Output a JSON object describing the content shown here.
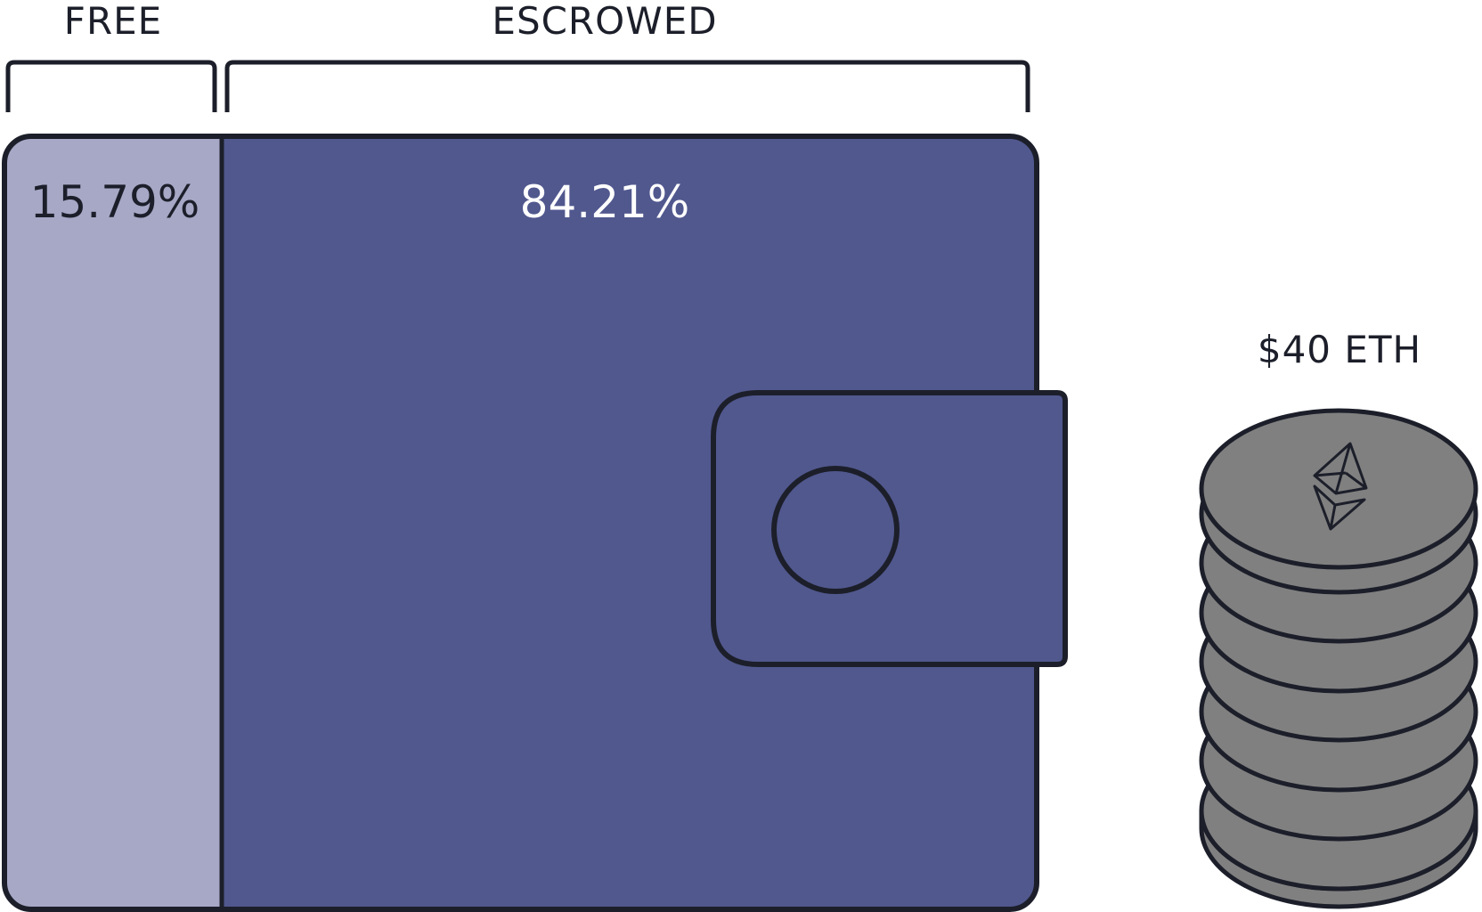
{
  "sections": {
    "free": {
      "label": "FREE",
      "percent_text": "15.79%",
      "share_percent": 15.79
    },
    "escrowed": {
      "label": "ESCROWED",
      "percent_text": "84.21%",
      "share_percent": 84.21
    }
  },
  "coin_stack": {
    "label": "$40 ETH",
    "coin_count": 8,
    "icon": "ethereum-icon"
  },
  "colors": {
    "outline": "#1c1f2a",
    "free_fill": "#a7a8c6",
    "escrowed_fill": "#51588e",
    "coin_fill": "#808080",
    "label_text": "#1c1f2a",
    "escrowed_text": "#ffffff",
    "background": "#ffffff"
  }
}
